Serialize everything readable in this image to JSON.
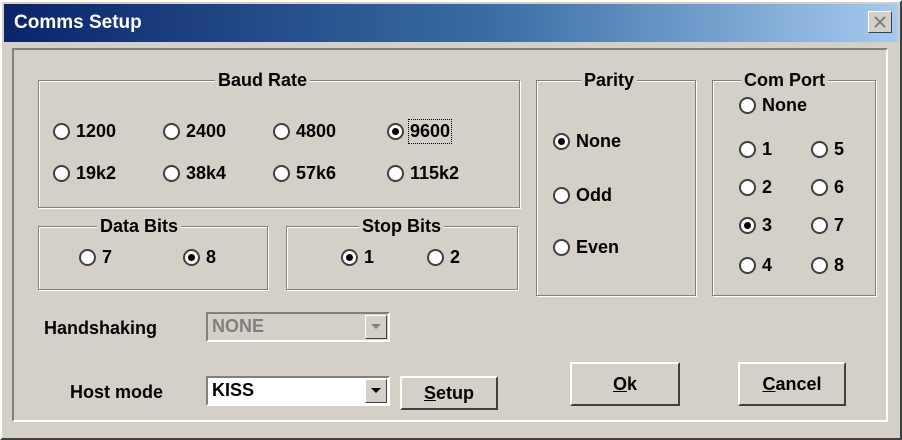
{
  "window": {
    "title": "Comms Setup"
  },
  "baud_rate": {
    "legend": "Baud Rate",
    "options": [
      "1200",
      "2400",
      "4800",
      "9600",
      "19k2",
      "38k4",
      "57k6",
      "115k2"
    ],
    "selected": "9600"
  },
  "parity": {
    "legend": "Parity",
    "options": [
      "None",
      "Odd",
      "Even"
    ],
    "selected": "None"
  },
  "com_port": {
    "legend": "Com Port",
    "options": [
      "None",
      "1",
      "5",
      "2",
      "6",
      "3",
      "7",
      "4",
      "8"
    ],
    "selected": "3"
  },
  "data_bits": {
    "legend": "Data Bits",
    "options": [
      "7",
      "8"
    ],
    "selected": "8"
  },
  "stop_bits": {
    "legend": "Stop Bits",
    "options": [
      "1",
      "2"
    ],
    "selected": "1"
  },
  "handshaking": {
    "label": "Handshaking",
    "value": "NONE",
    "enabled": false
  },
  "host_mode": {
    "label": "Host mode",
    "value": "KISS"
  },
  "buttons": {
    "setup": {
      "mnemonic": "S",
      "rest": "etup"
    },
    "ok": {
      "mnemonic": "O",
      "rest": "k"
    },
    "cancel": {
      "mnemonic": "C",
      "rest": "ancel"
    }
  }
}
